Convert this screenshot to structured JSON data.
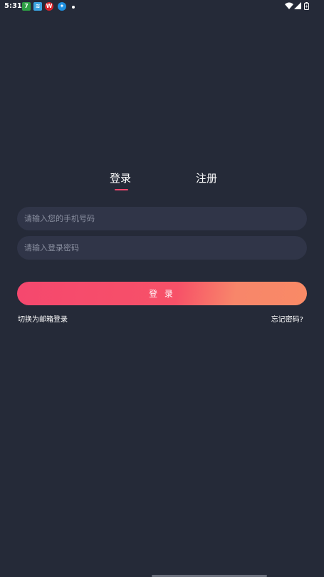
{
  "status_bar": {
    "time": "5:31",
    "notification_icons": [
      "7",
      "≋",
      "W",
      "✦"
    ]
  },
  "tabs": [
    {
      "label": "登录",
      "active": true
    },
    {
      "label": "注册",
      "active": false
    }
  ],
  "form": {
    "phone_placeholder": "请输入您的手机号码",
    "phone_value": "",
    "password_placeholder": "请输入登录密码",
    "password_value": "",
    "login_button_label": "登 录"
  },
  "links": {
    "switch_email": "切换为邮箱登录",
    "forgot_password": "忘记密码?"
  },
  "colors": {
    "background": "#252a38",
    "input_background": "#303548",
    "accent": "#f5486e",
    "accent_end": "#f98a66"
  }
}
